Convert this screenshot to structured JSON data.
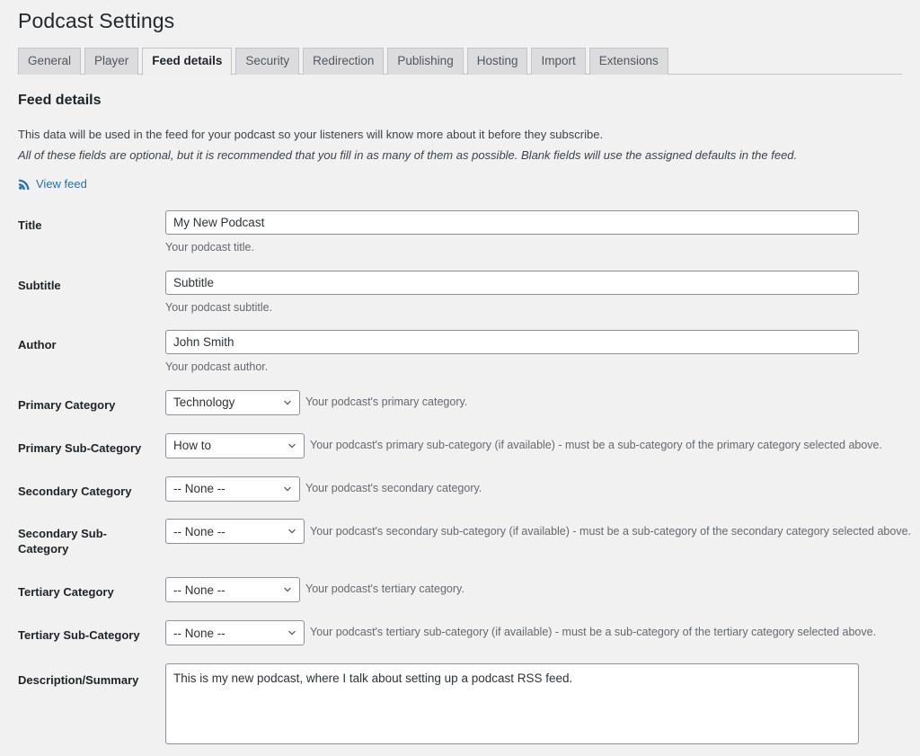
{
  "page": {
    "title": "Podcast Settings"
  },
  "tabs": [
    {
      "label": "General",
      "active": false
    },
    {
      "label": "Player",
      "active": false
    },
    {
      "label": "Feed details",
      "active": true
    },
    {
      "label": "Security",
      "active": false
    },
    {
      "label": "Redirection",
      "active": false
    },
    {
      "label": "Publishing",
      "active": false
    },
    {
      "label": "Hosting",
      "active": false
    },
    {
      "label": "Import",
      "active": false
    },
    {
      "label": "Extensions",
      "active": false
    }
  ],
  "section": {
    "title": "Feed details",
    "description": "This data will be used in the feed for your podcast so your listeners will know more about it before they subscribe.",
    "description_italic": "All of these fields are optional, but it is recommended that you fill in as many of them as possible. Blank fields will use the assigned defaults in the feed.",
    "view_feed_label": "View feed",
    "rss_icon": "rss-feed-icon",
    "link_color": "#2271b1"
  },
  "fields": {
    "title": {
      "label": "Title",
      "value": "My New Podcast",
      "placeholder": "",
      "description": "Your podcast title."
    },
    "subtitle": {
      "label": "Subtitle",
      "value": "Subtitle",
      "placeholder": "",
      "description": "Your podcast subtitle."
    },
    "author": {
      "label": "Author",
      "value": "John Smith",
      "placeholder": "",
      "description": "Your podcast author."
    },
    "primary_category": {
      "label": "Primary Category",
      "value": "Technology",
      "description": "Your podcast's primary category."
    },
    "primary_subcategory": {
      "label": "Primary Sub-Category",
      "value": "How to",
      "description": "Your podcast's primary sub-category (if available) - must be a sub-category of the primary category selected above."
    },
    "secondary_category": {
      "label": "Secondary Category",
      "value": "-- None --",
      "description": "Your podcast's secondary category."
    },
    "secondary_subcategory": {
      "label": "Secondary Sub-Category",
      "value": "-- None --",
      "description": "Your podcast's secondary sub-category (if available) - must be a sub-category of the secondary category selected above."
    },
    "tertiary_category": {
      "label": "Tertiary Category",
      "value": "-- None --",
      "description": "Your podcast's tertiary category."
    },
    "tertiary_subcategory": {
      "label": "Tertiary Sub-Category",
      "value": "-- None --",
      "description": "Your podcast's tertiary sub-category (if available) - must be a sub-category of the tertiary category selected above."
    },
    "description_summary": {
      "label": "Description/Summary",
      "value": "This is my new podcast, where I talk about setting up a podcast RSS feed.",
      "placeholder": ""
    }
  }
}
